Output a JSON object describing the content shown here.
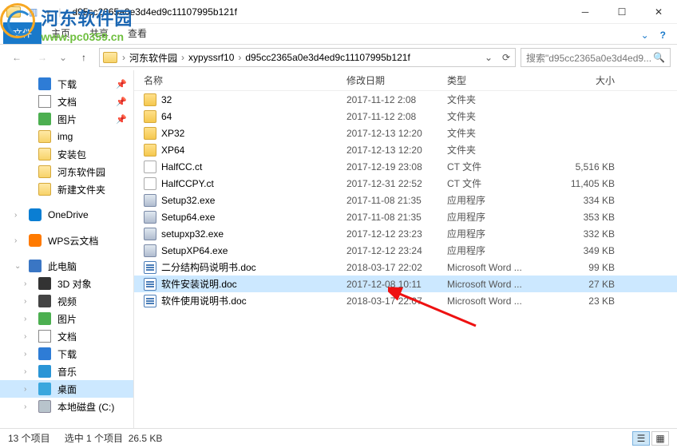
{
  "window": {
    "title": "d95cc2365a0e3d4ed9c11107995b121f"
  },
  "ribbon": {
    "file": "文件",
    "home": "主页",
    "share": "共享",
    "view": "查看"
  },
  "breadcrumb": [
    "河东软件园",
    "xypyssrf10",
    "d95cc2365a0e3d4ed9c11107995b121f"
  ],
  "search": {
    "placeholder": "搜索\"d95cc2365a0e3d4ed9..."
  },
  "sidebar": [
    {
      "label": "下载",
      "icon": "ico-dl",
      "pinned": true,
      "lv": 2
    },
    {
      "label": "文档",
      "icon": "ico-doc",
      "pinned": true,
      "lv": 2
    },
    {
      "label": "图片",
      "icon": "ico-pic",
      "pinned": true,
      "lv": 2
    },
    {
      "label": "img",
      "icon": "ico-folder",
      "lv": 2
    },
    {
      "label": "安装包",
      "icon": "ico-folder",
      "lv": 2
    },
    {
      "label": "河东软件园",
      "icon": "ico-folder",
      "lv": 2
    },
    {
      "label": "新建文件夹",
      "icon": "ico-folder",
      "lv": 2
    },
    {
      "spacer": true
    },
    {
      "label": "OneDrive",
      "icon": "ico-onedrive",
      "exp": "›",
      "lv": 1
    },
    {
      "spacer": true
    },
    {
      "label": "WPS云文档",
      "icon": "ico-wps",
      "exp": "›",
      "lv": 1
    },
    {
      "spacer": true
    },
    {
      "label": "此电脑",
      "icon": "ico-pc",
      "exp": "⌄",
      "lv": 1
    },
    {
      "label": "3D 对象",
      "icon": "ico-3d",
      "exp": "›",
      "lv": 2
    },
    {
      "label": "视频",
      "icon": "ico-video",
      "exp": "›",
      "lv": 2
    },
    {
      "label": "图片",
      "icon": "ico-pic",
      "exp": "›",
      "lv": 2
    },
    {
      "label": "文档",
      "icon": "ico-doc",
      "exp": "›",
      "lv": 2
    },
    {
      "label": "下载",
      "icon": "ico-dl",
      "exp": "›",
      "lv": 2
    },
    {
      "label": "音乐",
      "icon": "ico-music",
      "exp": "›",
      "lv": 2
    },
    {
      "label": "桌面",
      "icon": "ico-desktop",
      "exp": "›",
      "lv": 2,
      "selected": true
    },
    {
      "label": "本地磁盘 (C:)",
      "icon": "ico-disk",
      "exp": "›",
      "lv": 2
    }
  ],
  "columns": {
    "name": "名称",
    "date": "修改日期",
    "type": "类型",
    "size": "大小"
  },
  "files": [
    {
      "name": "32",
      "date": "2017-11-12 2:08",
      "type": "文件夹",
      "size": "",
      "icon": "fi-folder"
    },
    {
      "name": "64",
      "date": "2017-11-12 2:08",
      "type": "文件夹",
      "size": "",
      "icon": "fi-folder"
    },
    {
      "name": "XP32",
      "date": "2017-12-13 12:20",
      "type": "文件夹",
      "size": "",
      "icon": "fi-folder"
    },
    {
      "name": "XP64",
      "date": "2017-12-13 12:20",
      "type": "文件夹",
      "size": "",
      "icon": "fi-folder"
    },
    {
      "name": "HalfCC.ct",
      "date": "2017-12-19 23:08",
      "type": "CT 文件",
      "size": "5,516 KB",
      "icon": "fi-ct"
    },
    {
      "name": "HalfCCPY.ct",
      "date": "2017-12-31 22:52",
      "type": "CT 文件",
      "size": "11,405 KB",
      "icon": "fi-ct"
    },
    {
      "name": "Setup32.exe",
      "date": "2017-11-08 21:35",
      "type": "应用程序",
      "size": "334 KB",
      "icon": "fi-exe"
    },
    {
      "name": "Setup64.exe",
      "date": "2017-11-08 21:35",
      "type": "应用程序",
      "size": "353 KB",
      "icon": "fi-exe"
    },
    {
      "name": "setupxp32.exe",
      "date": "2017-12-12 23:23",
      "type": "应用程序",
      "size": "332 KB",
      "icon": "fi-exe"
    },
    {
      "name": "SetupXP64.exe",
      "date": "2017-12-12 23:24",
      "type": "应用程序",
      "size": "349 KB",
      "icon": "fi-exe"
    },
    {
      "name": "二分结构码说明书.doc",
      "date": "2018-03-17 22:02",
      "type": "Microsoft Word ...",
      "size": "99 KB",
      "icon": "fi-doc"
    },
    {
      "name": "软件安装说明.doc",
      "date": "2017-12-08 10:11",
      "type": "Microsoft Word ...",
      "size": "27 KB",
      "icon": "fi-doc",
      "selected": true
    },
    {
      "name": "软件使用说明书.doc",
      "date": "2018-03-17 22:07",
      "type": "Microsoft Word ...",
      "size": "23 KB",
      "icon": "fi-doc"
    }
  ],
  "status": {
    "count": "13 个项目",
    "selection": "选中 1 个项目",
    "size": "26.5 KB"
  },
  "watermark": {
    "cn": "河东软件园",
    "url": "www.pc0359.cn"
  }
}
